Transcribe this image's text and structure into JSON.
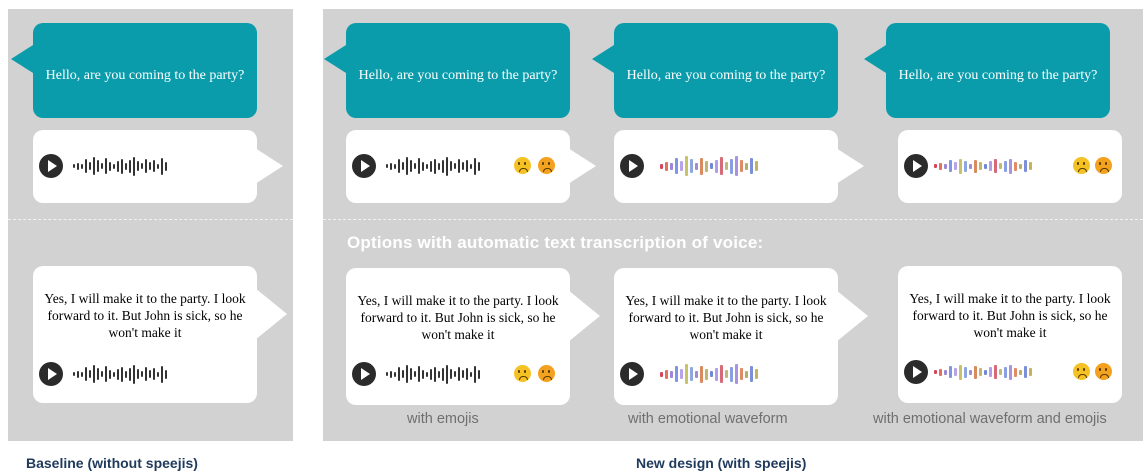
{
  "greeting": "Hello, are you coming to the party?",
  "reply": "Yes, I will make it to the party. I look forward to it. But John is sick, so he won't make it",
  "options_heading": "Options with automatic text transcription of voice:",
  "captions": {
    "emojis": "with emojis",
    "waveform": "with emotional waveform",
    "waveform_emojis": "with emotional waveform and emojis"
  },
  "footer": {
    "baseline": "Baseline (without speejis)",
    "new_design": "New design (with speejis)"
  },
  "icons": {
    "play": "play-icon",
    "emoji_1": "confused-face-emoji",
    "emoji_2": "sad-face-emoji"
  },
  "colors": {
    "panel": "#d2d2d2",
    "teal_bubble": "#0a9cab",
    "footer_text": "#1f3a5c"
  }
}
